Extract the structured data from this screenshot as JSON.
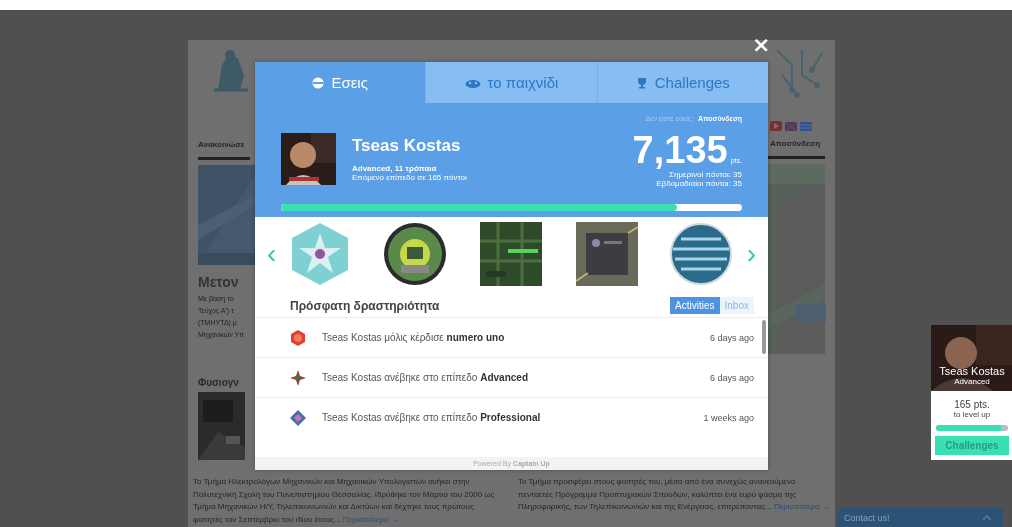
{
  "site": {
    "nav_left": "Ανακοινώσε",
    "heading_left": "Μετον",
    "lines_left": [
      "Με βάση το",
      "Τεύχος Α') τ",
      "(ΤΜΗΥΤΔ) μ",
      "Μηχανικών Υπ"
    ],
    "section_left": "Φυσιογν",
    "nav_right": "Αποσύνδεση",
    "paragraph_left": {
      "text": "Το Τμήμα Ηλεκτρολόγων Μηχανικών και Μηχανικών Υπολογιστών ανήκει στην Πολυτεχνική Σχολή του Πανεπιστημίου Θεσσαλίας. Ιδρύθηκε τον Μάρτιο του 2000 ως Τμήμα Μηχανικών Η/Υ, Τηλεπικοινωνιών και Δικτύων και δέχτηκε τους πρώτους φοιτητές τον Σεπτέμβριο του ιδίου έτους...",
      "link": "Περισσότερα →"
    },
    "paragraph_right": {
      "text": "Το Τμήμα προσφέρει στους φοιτητές του, μέσα από ένα συνεχώς ανανεούμενο πενταετές Πρόγραμμα Προπτυχιακών Σπουδών, καλύπτει ένα ευρύ φάσμα της Πληροφορικής, των Τηλεπικοινωνιών και της Ενέργειας, επιτρέποντας...",
      "link": "Περισσότερα →"
    }
  },
  "modal": {
    "close": "×",
    "tabs": [
      {
        "label": "Εσεις",
        "selected": true
      },
      {
        "label": "το παιχνίδι",
        "selected": false
      },
      {
        "label": "Challenges",
        "selected": false
      }
    ],
    "logout_prompt": "Δεν είστε εσείς;",
    "logout_link": "Αποσύνδεση",
    "user": {
      "name": "Tseas Kostas",
      "rank": "Advanced, 11 τρόπαια",
      "next_level": "Επόμενο επίπεδο σε 165 πόντοι"
    },
    "points": {
      "value": "7,135",
      "unit": "pts.",
      "today": "Σημερινοί πόντοι: 35",
      "weekly": "Εβδομαδιαίοι πόντοι: 35"
    },
    "progress": {
      "level": 0.86
    },
    "carousel": {
      "prev": "‹",
      "next": "›"
    },
    "activity": {
      "title": "Πρόσφατη δραστηριότητα",
      "tabs": [
        {
          "label": "Activities",
          "selected": true
        },
        {
          "label": "Inbox",
          "selected": false
        }
      ],
      "items": [
        {
          "text": "Tseas Kostas μόλις κέρδισε **numero uno**",
          "time": "6 days ago"
        },
        {
          "text": "Tseas Kostas ανέβηκε στο επίπεδο **Advanced**",
          "time": "6 days ago"
        },
        {
          "text": "Tseas Kostas ανέβηκε στο επίπεδο **Professional**",
          "time": "1 weeks ago"
        }
      ]
    },
    "footer": "Powered By **Captain Up**"
  },
  "widget": {
    "name": "Tseas Kostas",
    "rank": "Advanced",
    "points": "165 pts.",
    "caption": "to level up",
    "level": 0.9,
    "button": "Challenges"
  },
  "contact": "Contact us!"
}
